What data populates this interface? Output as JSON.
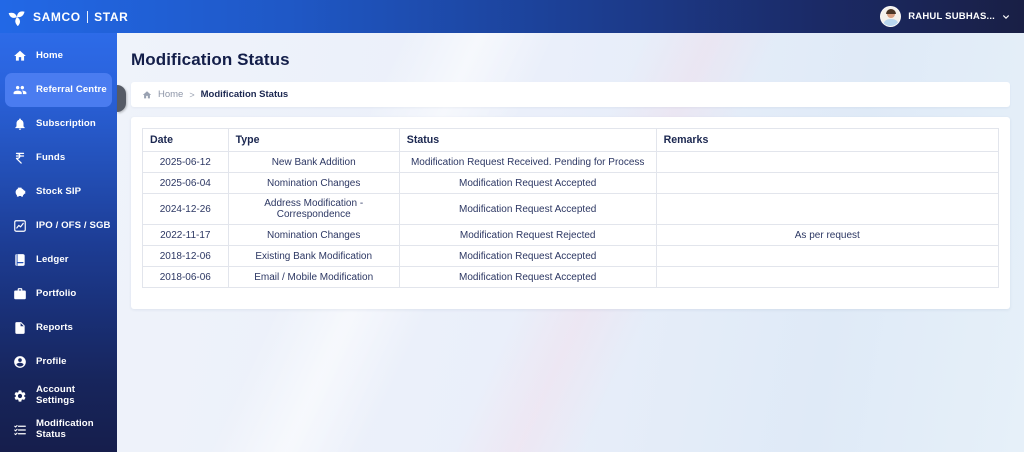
{
  "topbar": {
    "brand_primary": "SAMCO",
    "brand_secondary": "STAR",
    "user_name": "RAHUL SUBHAS..."
  },
  "sidebar": {
    "items": [
      {
        "label": "Home",
        "icon": "home-icon",
        "active": false
      },
      {
        "label": "Referral Centre",
        "icon": "referral-icon",
        "active": true
      },
      {
        "label": "Subscription",
        "icon": "bell-icon",
        "active": false
      },
      {
        "label": "Funds",
        "icon": "rupee-icon",
        "active": false
      },
      {
        "label": "Stock SIP",
        "icon": "piggy-bank-icon",
        "active": false
      },
      {
        "label": "IPO / OFS / SGB",
        "icon": "chart-icon",
        "active": false
      },
      {
        "label": "Ledger",
        "icon": "ledger-icon",
        "active": false
      },
      {
        "label": "Portfolio",
        "icon": "briefcase-icon",
        "active": false
      },
      {
        "label": "Reports",
        "icon": "report-icon",
        "active": false
      },
      {
        "label": "Profile",
        "icon": "profile-icon",
        "active": false
      },
      {
        "label": "Account Settings",
        "icon": "gear-icon",
        "active": false
      },
      {
        "label": "Modification Status",
        "icon": "checklist-icon",
        "active": false
      }
    ]
  },
  "page": {
    "title": "Modification Status",
    "breadcrumb": {
      "home": "Home",
      "separator": ">",
      "current": "Modification Status"
    }
  },
  "table": {
    "columns": [
      "Date",
      "Type",
      "Status",
      "Remarks"
    ],
    "column_widths": [
      "10%",
      "20%",
      "30%",
      "40%"
    ],
    "rows": [
      [
        "2025-06-12",
        "New Bank Addition",
        "Modification Request Received. Pending for Process",
        ""
      ],
      [
        "2025-06-04",
        "Nomination Changes",
        "Modification Request Accepted",
        ""
      ],
      [
        "2024-12-26",
        "Address Modification - Correspondence",
        "Modification Request Accepted",
        ""
      ],
      [
        "2022-11-17",
        "Nomination Changes",
        "Modification Request Rejected",
        "As per request"
      ],
      [
        "2018-12-06",
        "Existing Bank Modification",
        "Modification Request Accepted",
        ""
      ],
      [
        "2018-06-06",
        "Email / Mobile Modification",
        "Modification Request Accepted",
        ""
      ]
    ]
  },
  "colors": {
    "topbar_gradient_start": "#2268e6",
    "topbar_gradient_end": "#191f45",
    "sidebar_gradient_start": "#2d6be8",
    "sidebar_gradient_end": "#161e4c",
    "active_item_bg": "#4a7cf0",
    "text_navy": "#1c2851",
    "table_border": "#e2e5ec"
  }
}
